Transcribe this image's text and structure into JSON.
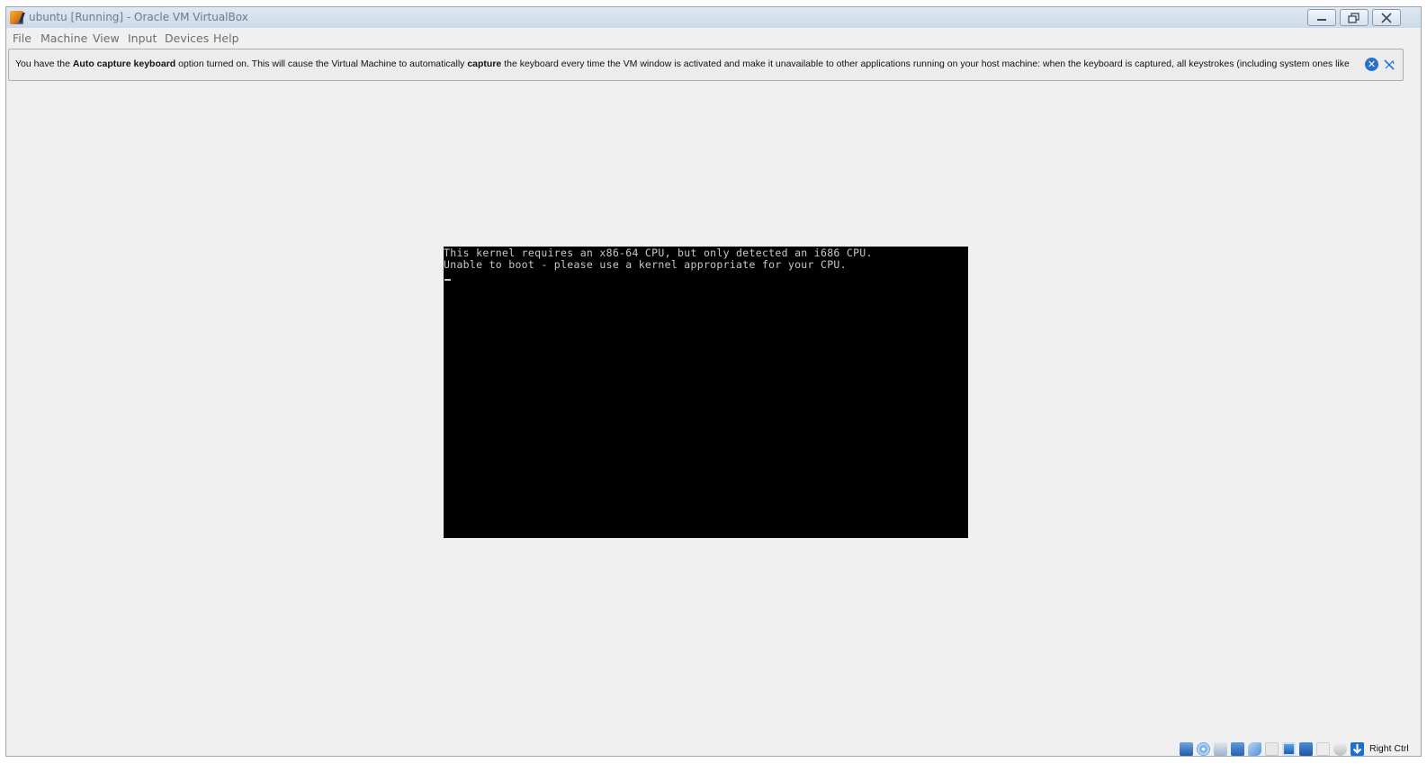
{
  "window": {
    "title": "ubuntu [Running] - Oracle VM VirtualBox",
    "controls": [
      "minimize",
      "restore",
      "close"
    ]
  },
  "menu": [
    "File",
    "Machine",
    "View",
    "Input",
    "Devices",
    "Help"
  ],
  "notice": {
    "part1": "You have the ",
    "bold1": "Auto capture keyboard",
    "part2": " option turned on. This will cause the Virtual Machine to automatically ",
    "bold2": "capture",
    "part3": " the keyboard every time the VM window is activated and make it unavailable to other applications running on your host machine: when the keyboard is captured, all keystrokes (including system ones like",
    "close_glyph": "✕"
  },
  "console": {
    "lines": [
      "This kernel requires an x86-64 CPU, but only detected an i686 CPU.",
      "Unable to boot - please use a kernel appropriate for your CPU."
    ]
  },
  "statusbar": {
    "icons": [
      "hard-disk-icon",
      "optical-drive-icon",
      "audio-icon",
      "network-icon",
      "usb-icon",
      "shared-folders-icon",
      "display-icon",
      "video-capture-icon",
      "virtualization-icon",
      "mouse-integration-icon",
      "keyboard-capture-icon"
    ],
    "host_key": "Right Ctrl"
  },
  "colors": {
    "accent": "#2a72c9",
    "background": "#f0f0f0",
    "console_bg": "#000000",
    "console_fg": "#c8c8c8"
  }
}
